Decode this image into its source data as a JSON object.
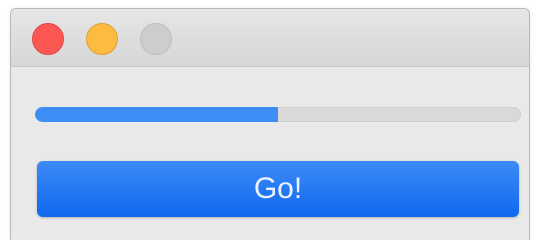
{
  "window": {
    "controls": [
      {
        "name": "close",
        "icon": "close-icon",
        "color": "#fc5753",
        "border": "#df4744"
      },
      {
        "name": "minimize",
        "icon": "minimize-icon",
        "color": "#fdbc40",
        "border": "#de9f34"
      },
      {
        "name": "zoom",
        "icon": "zoom-icon",
        "color": "#cdcdcd",
        "border": "#bdbdbd"
      }
    ]
  },
  "progress": {
    "value_fraction": 0.5,
    "fill_color": "#3d8df5",
    "track_color": "#d9d9d9"
  },
  "action_button": {
    "label": "Go!",
    "color_top": "#3d8bf7",
    "color_bottom": "#1068ee"
  }
}
